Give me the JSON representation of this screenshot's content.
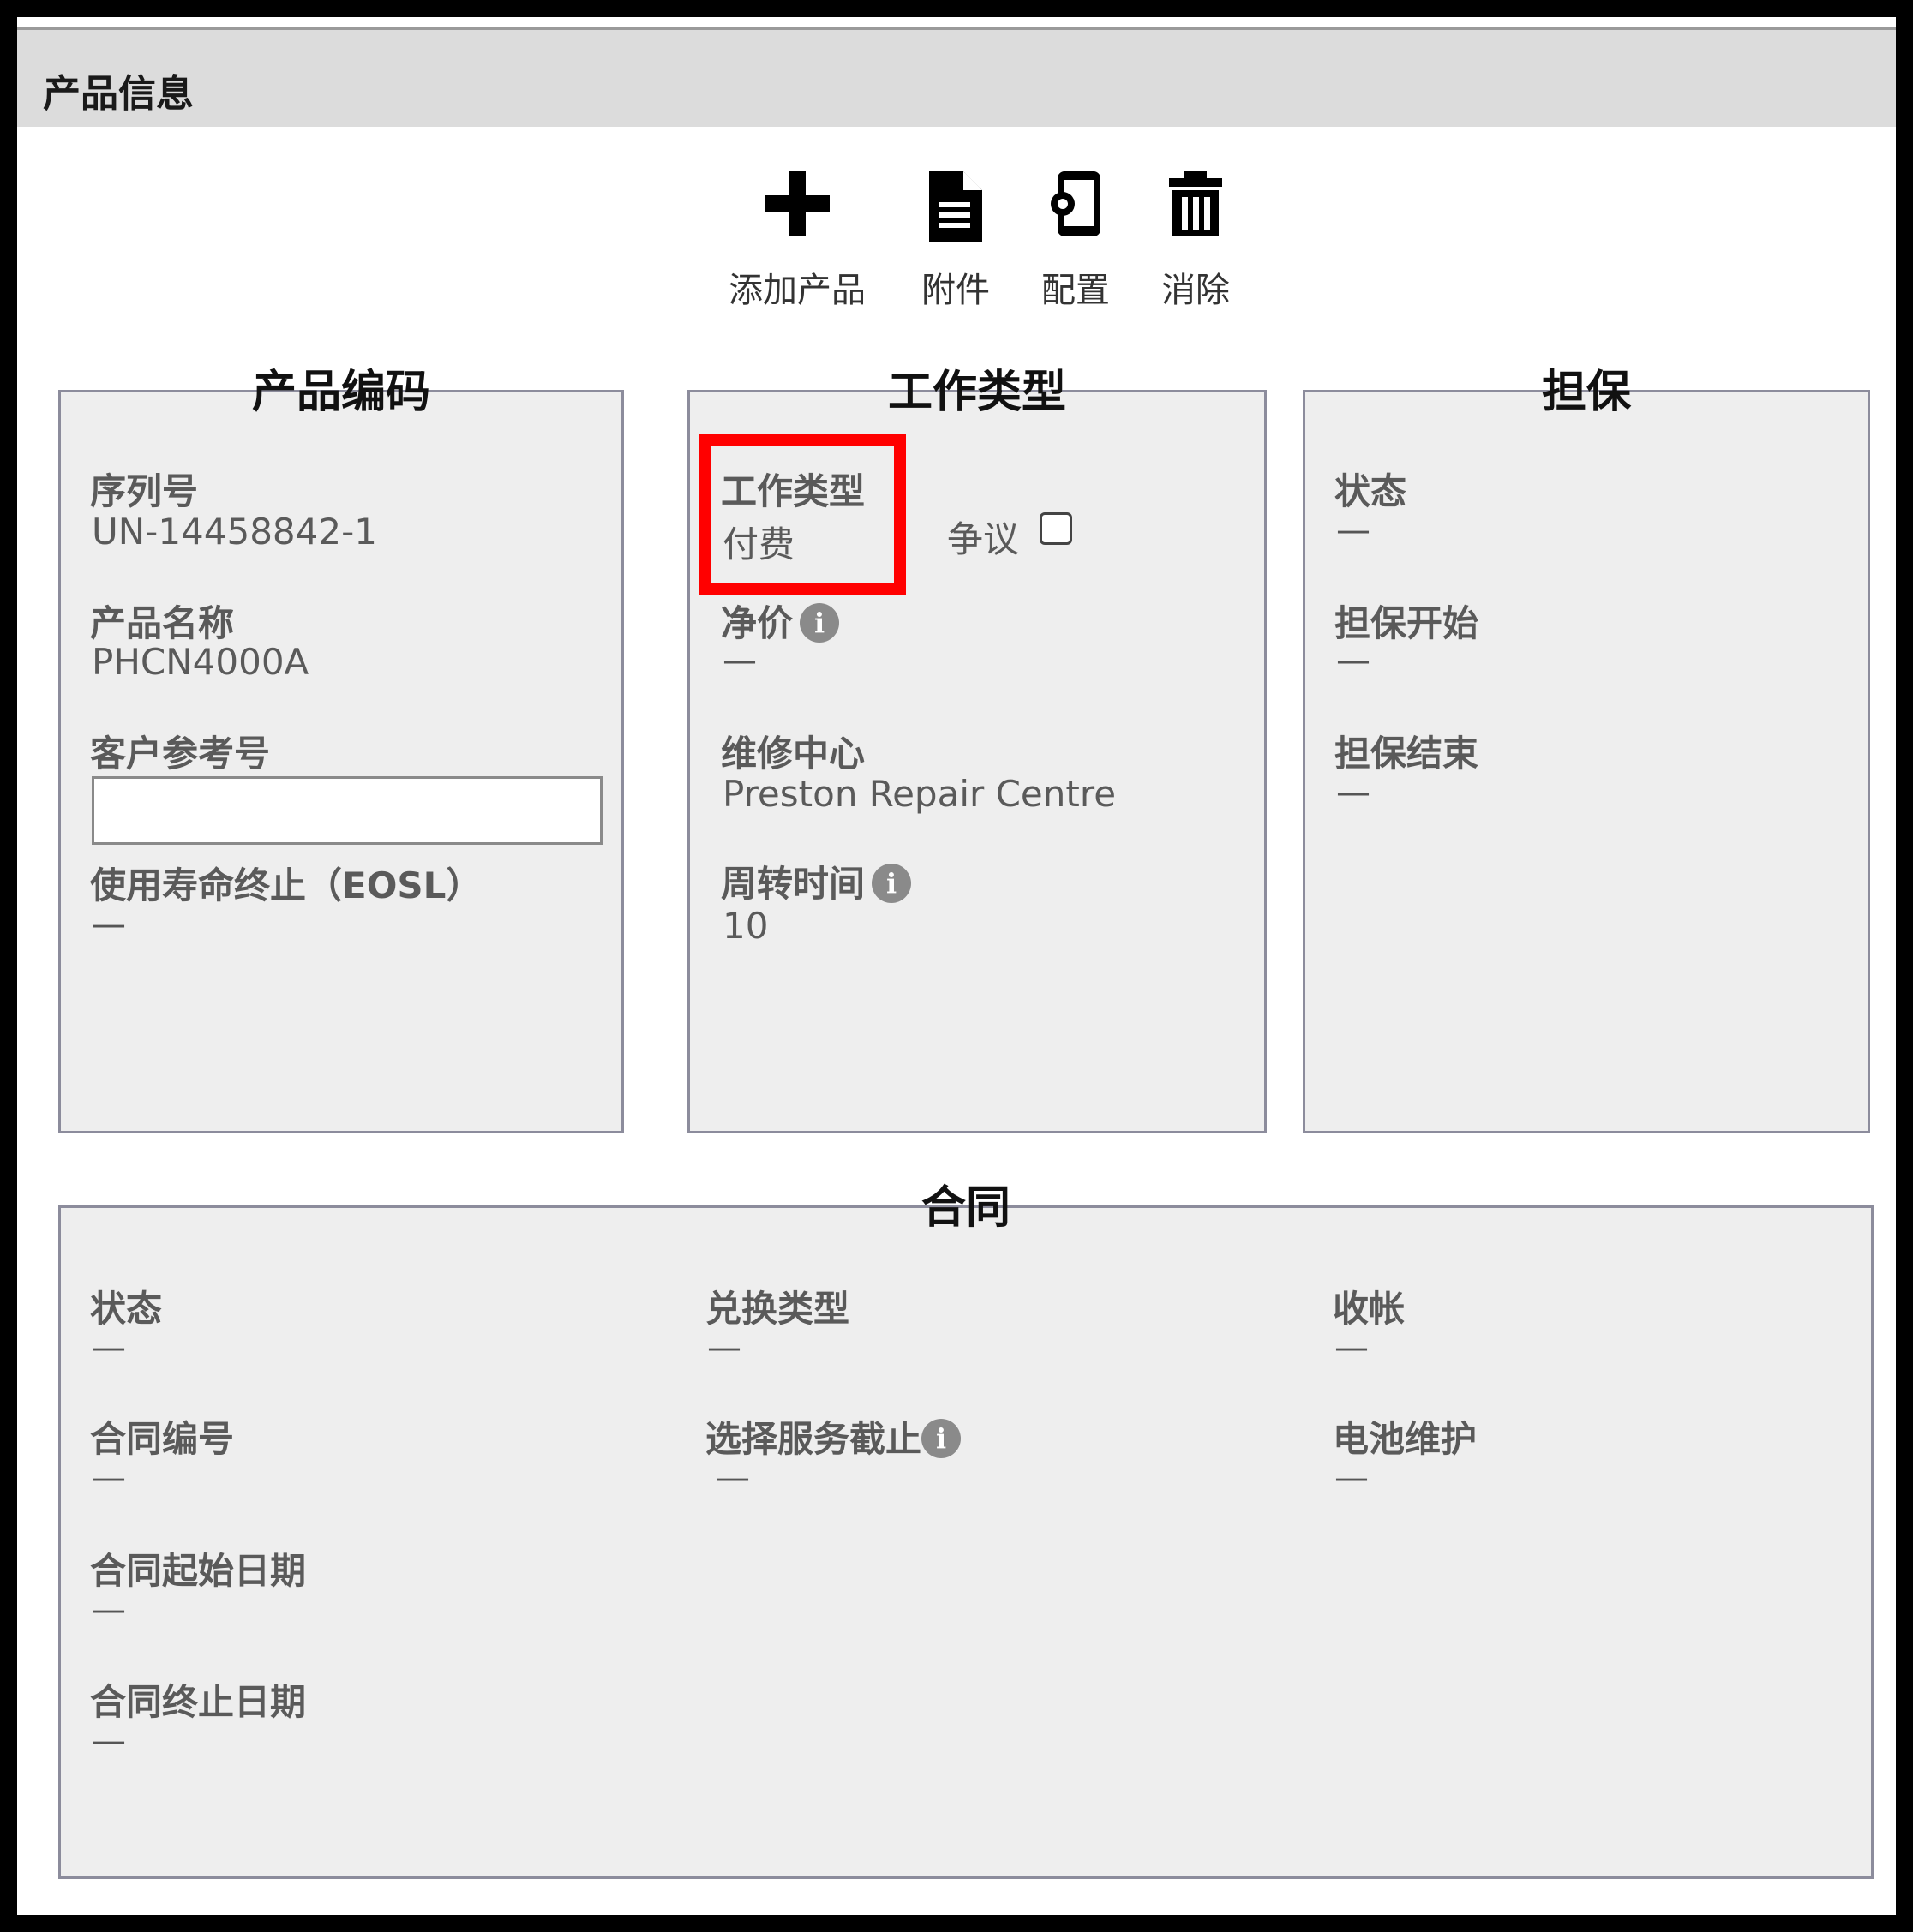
{
  "header": {
    "title": "产品信息"
  },
  "toolbar": {
    "add": {
      "label": "添加产品",
      "icon": "plus-icon"
    },
    "attachment": {
      "label": "附件",
      "icon": "document-icon"
    },
    "config": {
      "label": "配置",
      "icon": "device-settings-icon"
    },
    "remove": {
      "label": "消除",
      "icon": "trash-icon"
    }
  },
  "product_code": {
    "legend": "产品编码",
    "serial_label": "序列号",
    "serial_value": "UN-14458842-1",
    "name_label": "产品名称",
    "name_value": "PHCN4000A",
    "customer_ref_label": "客户参考号",
    "customer_ref_value": "",
    "eosl_label": "使用寿命终止（EOSL）",
    "eosl_value": "—"
  },
  "work_type": {
    "legend": "工作类型",
    "type_label": "工作类型",
    "type_value": "付费",
    "dispute_label": "争议",
    "dispute_checked": false,
    "net_price_label": "净价",
    "net_price_value": "—",
    "repair_center_label": "维修中心",
    "repair_center_value": "Preston Repair Centre",
    "turnaround_label": "周转时间",
    "turnaround_value": "10",
    "highlight_color": "#ff0000"
  },
  "warranty": {
    "legend": "担保",
    "status_label": "状态",
    "status_value": "—",
    "start_label": "担保开始",
    "start_value": "—",
    "end_label": "担保结束",
    "end_value": "—"
  },
  "contract": {
    "legend": "合同",
    "status_label": "状态",
    "status_value": "—",
    "number_label": "合同编号",
    "number_value": "—",
    "start_label": "合同起始日期",
    "start_value": "—",
    "end_label": "合同终止日期",
    "end_value": "—",
    "exchange_type_label": "兑换类型",
    "exchange_type_value": "—",
    "service_cutoff_label": "选择服务截止",
    "service_cutoff_value": "—",
    "billing_label": "收帐",
    "billing_value": "—",
    "battery_label": "电池维护",
    "battery_value": "—"
  }
}
